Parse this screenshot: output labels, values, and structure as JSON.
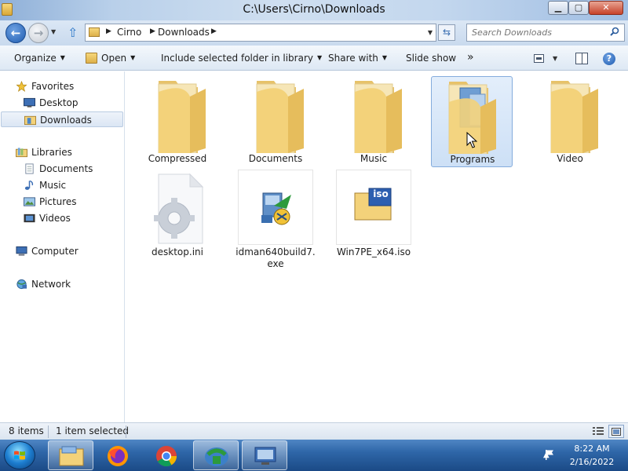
{
  "window": {
    "title": "C:\\Users\\Cirno\\Downloads"
  },
  "address": {
    "crumbs": [
      "Cirno",
      "Downloads"
    ],
    "search_placeholder": "Search Downloads"
  },
  "commands": {
    "organize": "Organize",
    "open": "Open",
    "include": "Include selected folder in library",
    "share": "Share with",
    "slideshow": "Slide show",
    "more": "»"
  },
  "nav": {
    "favorites": "Favorites",
    "desktop": "Desktop",
    "downloads": "Downloads",
    "libraries": "Libraries",
    "documents": "Documents",
    "music": "Music",
    "pictures": "Pictures",
    "videos": "Videos",
    "computer": "Computer",
    "network": "Network"
  },
  "files": [
    {
      "name": "Compressed"
    },
    {
      "name": "Documents"
    },
    {
      "name": "Music"
    },
    {
      "name": "Programs"
    },
    {
      "name": "Video"
    },
    {
      "name": "desktop.ini"
    },
    {
      "name_line1": "idman640build7.",
      "name_line2": "exe"
    },
    {
      "name": "Win7PE_x64.iso"
    }
  ],
  "iso_label": "iso",
  "status": {
    "count": "8 items",
    "selected": "1 item selected"
  },
  "clock": {
    "time": "8:22 AM",
    "date": "2/16/2022"
  },
  "colors": {
    "accent": "#2e66a8",
    "selection": "#cde0f6",
    "folder": "#f3d27a"
  }
}
